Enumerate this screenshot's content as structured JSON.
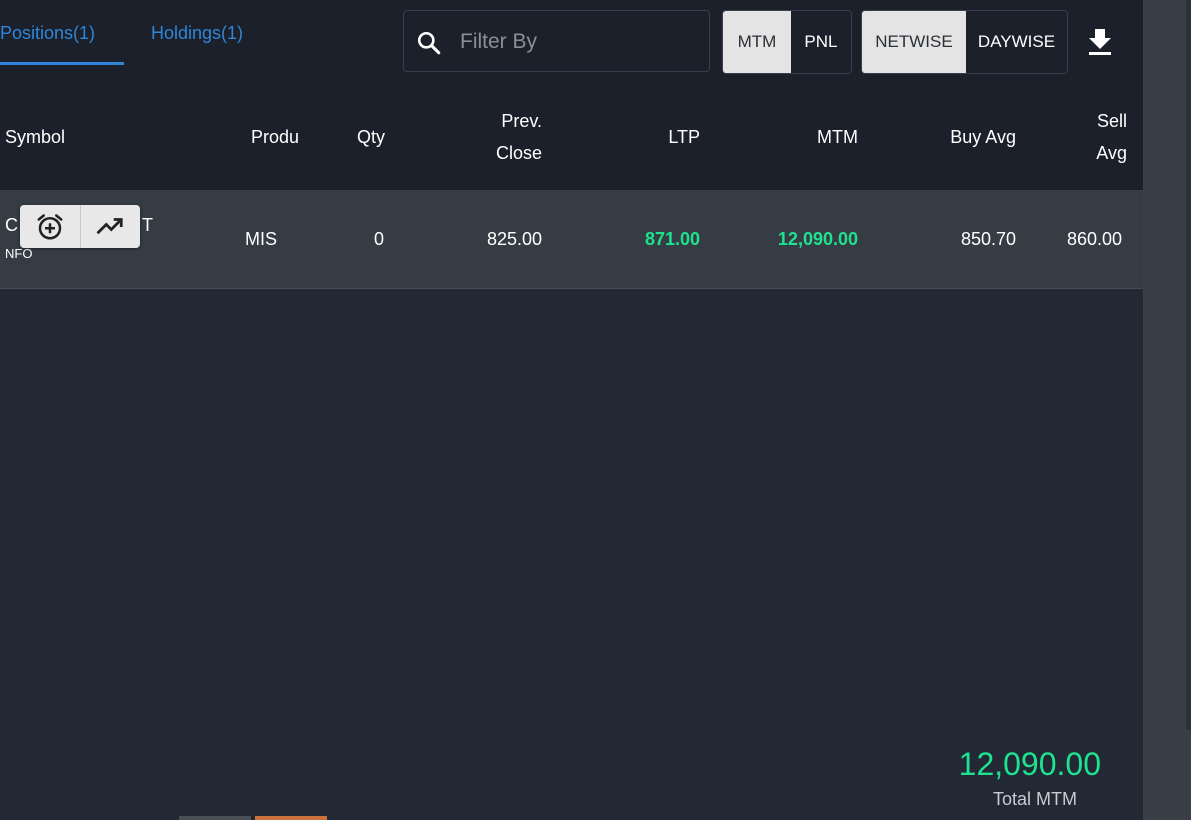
{
  "tabs": [
    {
      "label": "Positions(1)",
      "active": true
    },
    {
      "label": "Holdings(1)",
      "active": false
    }
  ],
  "filter": {
    "placeholder": "Filter By",
    "value": ""
  },
  "toggles": {
    "mode": {
      "options": [
        "MTM",
        "PNL"
      ],
      "selected": "MTM"
    },
    "view": {
      "options": [
        "NETWISE",
        "DAYWISE"
      ],
      "selected": "NETWISE"
    }
  },
  "icons": {
    "search": "search-icon",
    "download": "download-icon",
    "alarm": "alarm-add-icon",
    "chart": "trending-up-icon"
  },
  "table": {
    "headers": {
      "symbol": "Symbol",
      "product": "Produ",
      "qty": "Qty",
      "prev_close_1": "Prev.",
      "prev_close_2": "Close",
      "ltp": "LTP",
      "mtm": "MTM",
      "buy_avg": "Buy Avg",
      "sell_avg_1": "Sell",
      "sell_avg_2": "Avg"
    },
    "rows": [
      {
        "symbol_left": "C",
        "symbol_right": "T",
        "exchange": "NFO",
        "product": "MIS",
        "qty": "0",
        "prev_close": "825.00",
        "ltp": "871.00",
        "mtm": "12,090.00",
        "buy_avg": "850.70",
        "sell_avg": "860.00"
      }
    ]
  },
  "totals": {
    "value": "12,090.00",
    "label": "Total MTM"
  },
  "colors": {
    "accent": "#2f86d8",
    "profit": "#1ee28f",
    "background": "#222834",
    "header_bg": "#1b202b",
    "row_bg": "#363c44"
  }
}
